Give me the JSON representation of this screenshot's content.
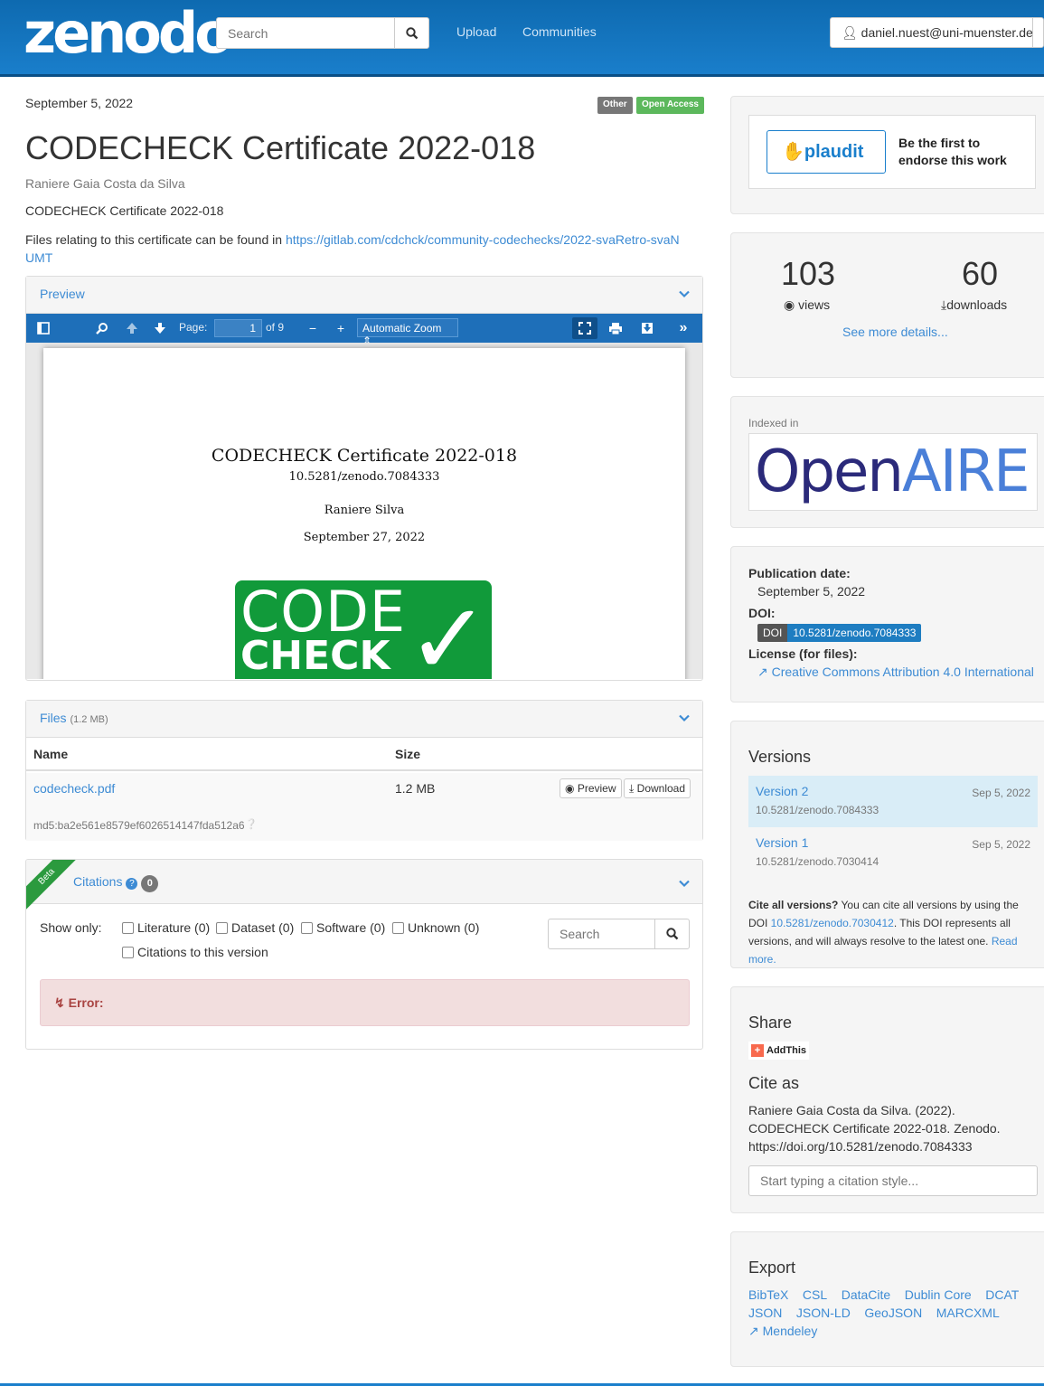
{
  "header": {
    "logo": "zenodo",
    "search_placeholder": "Search",
    "nav": [
      "Upload",
      "Communities"
    ],
    "user": "daniel.nuest@uni-muenster.de"
  },
  "record": {
    "date": "September 5, 2022",
    "badges": [
      {
        "label": "Other",
        "color": "#777777"
      },
      {
        "label": "Open Access",
        "color": "#5cb85c"
      }
    ],
    "title": "CODECHECK Certificate 2022-018",
    "authors": "Raniere Gaia Costa da Silva",
    "description": "CODECHECK Certificate 2022-018",
    "files_text": "Files relating to this certificate can be found in ",
    "files_link": "https://gitlab.com/cdchck/community-codechecks/2022-svaRetro-svaNUMT"
  },
  "preview": {
    "heading": "Preview",
    "page_label": "Page:",
    "page_value": "1",
    "page_of": "of 9",
    "zoom": "Automatic Zoom",
    "pdf": {
      "title": "CODECHECK Certificate 2022-018",
      "doi": "10.5281/zenodo.7084333",
      "author": "Raniere Silva",
      "date": "September 27, 2022",
      "logo_line1": "CODE",
      "logo_line2": "CHECK",
      "logo_check": "✓"
    }
  },
  "files": {
    "heading": "Files",
    "size_total": "(1.2 MB)",
    "col_name": "Name",
    "col_size": "Size",
    "rows": [
      {
        "name": "codecheck.pdf",
        "size": "1.2 MB",
        "md5": "md5:ba2e561e8579ef6026514147fda512a6"
      }
    ],
    "preview_btn": "Preview",
    "download_btn": "Download"
  },
  "citations": {
    "ribbon": "Beta",
    "heading": "Citations",
    "count": "0",
    "show_only": "Show only:",
    "filters": [
      "Literature (0)",
      "Dataset (0)",
      "Software (0)",
      "Unknown (0)"
    ],
    "this_version": "Citations to this version",
    "search_placeholder": "Search",
    "error": "Error:"
  },
  "plaudit": {
    "logo": "plaudit",
    "text": "Be the first to endorse this work"
  },
  "stats": {
    "views": "103",
    "views_label": "views",
    "downloads": "60",
    "downloads_label": "downloads",
    "more": "See more details..."
  },
  "indexed": {
    "label": "Indexed in",
    "logo_a": "Open",
    "logo_b": "AIRE"
  },
  "meta": {
    "pub_label": "Publication date:",
    "pub_value": "September 5, 2022",
    "doi_label": "DOI:",
    "doi_tag": "DOI",
    "doi_value": "10.5281/zenodo.7084333",
    "license_label": "License (for files):",
    "license_value": "Creative Commons Attribution 4.0 International"
  },
  "versions": {
    "heading": "Versions",
    "items": [
      {
        "name": "Version 2",
        "date": "Sep 5, 2022",
        "doi": "10.5281/zenodo.7084333"
      },
      {
        "name": "Version 1",
        "date": "Sep 5, 2022",
        "doi": "10.5281/zenodo.7030414"
      }
    ],
    "cite_bold": "Cite all versions?",
    "cite_text1": " You can cite all versions by using the DOI ",
    "cite_doi": "10.5281/zenodo.7030412",
    "cite_text2": ". This DOI represents all versions, and will always resolve to the latest one. ",
    "read_more": "Read more."
  },
  "share": {
    "heading": "Share",
    "addthis": "AddThis",
    "cite_heading": "Cite as",
    "cite_text": "Raniere Gaia Costa da Silva. (2022). CODECHECK Certificate 2022-018. Zenodo. https://doi.org/10.5281/zenodo.7084333",
    "style_placeholder": "Start typing a citation style..."
  },
  "export": {
    "heading": "Export",
    "row1": [
      "BibTeX",
      "CSL",
      "DataCite",
      "Dublin Core",
      "DCAT"
    ],
    "row2": [
      "JSON",
      "JSON-LD",
      "GeoJSON",
      "MARCXML"
    ],
    "mendeley": "Mendeley"
  }
}
